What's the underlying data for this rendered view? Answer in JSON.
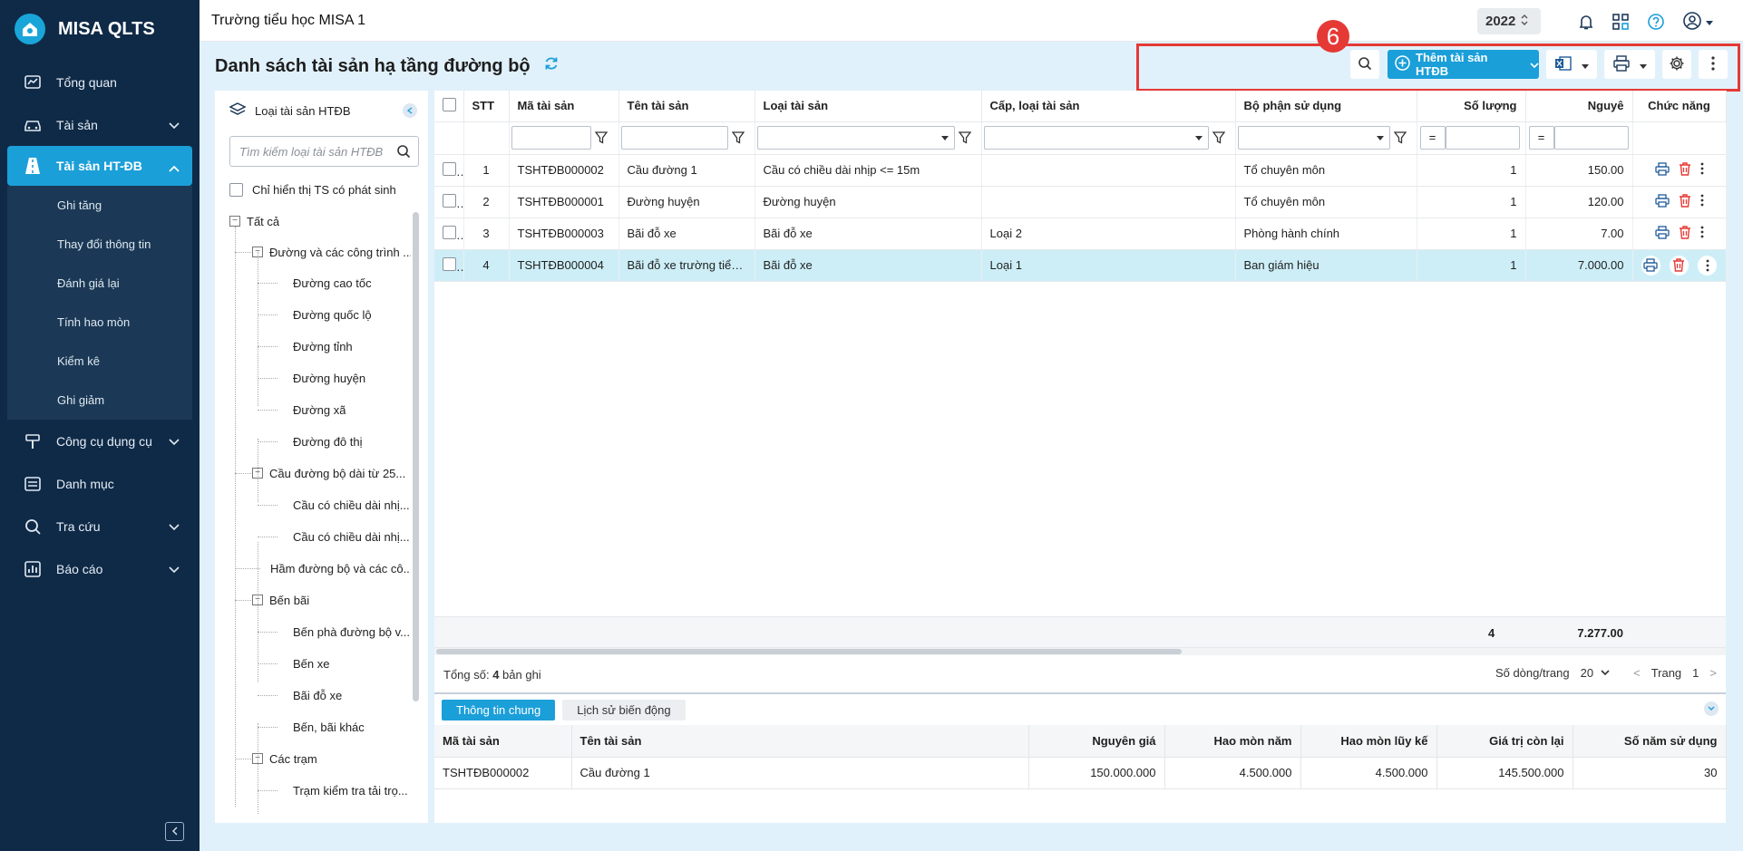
{
  "app": {
    "name": "MISA QLTS",
    "school": "Trường tiểu học MISA 1",
    "year": "2022"
  },
  "colors": {
    "sidebar_bg": "#0f2a47",
    "accent": "#1b9fd9",
    "highlight": "#e53935",
    "selected_row": "#cdeef7"
  },
  "sidebar": {
    "items": [
      {
        "label": "Tổng quan",
        "icon": "chart-icon"
      },
      {
        "label": "Tài sản",
        "icon": "car-icon"
      },
      {
        "label": "Tài sản HT-ĐB",
        "icon": "road-icon"
      },
      {
        "label": "Công cụ dụng cụ",
        "icon": "tools-icon"
      },
      {
        "label": "Danh mục",
        "icon": "list-icon"
      },
      {
        "label": "Tra cứu",
        "icon": "search-icon"
      },
      {
        "label": "Báo cáo",
        "icon": "report-icon"
      }
    ],
    "sub_items": [
      "Ghi tăng",
      "Thay đổi thông tin",
      "Đánh giá lại",
      "Tính hao mòn",
      "Kiểm kê",
      "Ghi giảm"
    ]
  },
  "page": {
    "title": "Danh sách tài sản hạ tầng đường bộ",
    "step_badge": "6",
    "add_label": "Thêm tài sản HTĐB"
  },
  "tree": {
    "title": "Loại tài sản HTĐB",
    "search_placeholder": "Tìm kiếm loại tài sản HTĐB",
    "only_changes_label": "Chỉ hiển thị TS có phát sinh",
    "nodes": [
      {
        "label": "Tất cả"
      },
      {
        "label": "Đường và các công trình ..."
      },
      {
        "label": "Đường cao tốc"
      },
      {
        "label": "Đường quốc lộ"
      },
      {
        "label": "Đường tỉnh"
      },
      {
        "label": "Đường huyện"
      },
      {
        "label": "Đường xã"
      },
      {
        "label": "Đường đô thị"
      },
      {
        "label": "Cầu đường bộ dài từ 25..."
      },
      {
        "label": "Cầu có chiều dài nhị..."
      },
      {
        "label": "Cầu có chiều dài nhị..."
      },
      {
        "label": "Hầm đường bộ và các cô..."
      },
      {
        "label": "Bến bãi"
      },
      {
        "label": "Bến phà đường bộ v..."
      },
      {
        "label": "Bến xe"
      },
      {
        "label": "Bãi đỗ xe"
      },
      {
        "label": "Bến, bãi khác"
      },
      {
        "label": "Các trạm"
      },
      {
        "label": "Trạm kiểm tra tải trọ..."
      }
    ]
  },
  "grid": {
    "headers": [
      "STT",
      "Mã tài sản",
      "Tên tài sản",
      "Loại tài sản",
      "Cấp, loại tài sản",
      "Bộ phận sử dụng",
      "Số lượng",
      "Nguyê",
      "Chức năng"
    ],
    "filter_equals": "=",
    "rows": [
      {
        "stt": "1",
        "code": "TSHTĐB000002",
        "name": "Cầu đường 1",
        "type": "Cầu có chiều dài nhịp <= 15m",
        "grade": "",
        "dept": "Tổ chuyên môn",
        "qty": "1",
        "cost": "150.00"
      },
      {
        "stt": "2",
        "code": "TSHTĐB000001",
        "name": "Đường huyện",
        "type": "Đường huyện",
        "grade": "",
        "dept": "Tổ chuyên môn",
        "qty": "1",
        "cost": "120.00"
      },
      {
        "stt": "3",
        "code": "TSHTĐB000003",
        "name": "Bãi đỗ xe",
        "type": "Bãi đỗ xe",
        "grade": "Loại 2",
        "dept": "Phòng hành chính",
        "qty": "1",
        "cost": "7.00"
      },
      {
        "stt": "4",
        "code": "TSHTĐB000004",
        "name": "Bãi đỗ xe trường tiểu h...",
        "type": "Bãi đỗ xe",
        "grade": "Loại 1",
        "dept": "Ban giám hiệu",
        "qty": "1",
        "cost": "7.000.00"
      }
    ],
    "totals": {
      "qty": "4",
      "cost": "7.277.00"
    }
  },
  "footer": {
    "total_prefix": "Tổng số: ",
    "total_count": "4",
    "total_suffix": " bản ghi",
    "page_size_label": "Số dòng/trang",
    "page_size": "20",
    "prev": "<",
    "page_label": "Trang",
    "page": "1",
    "next": ">"
  },
  "detail": {
    "tabs": [
      "Thông tin chung",
      "Lịch sử biến động"
    ],
    "headers": [
      "Mã tài sản",
      "Tên tài sản",
      "Nguyên giá",
      "Hao mòn năm",
      "Hao mòn lũy kế",
      "Giá trị còn lại",
      "Số năm sử dụng"
    ],
    "row": [
      "TSHTĐB000002",
      "Cầu đường 1",
      "150.000.000",
      "4.500.000",
      "4.500.000",
      "145.500.000",
      "30"
    ]
  }
}
